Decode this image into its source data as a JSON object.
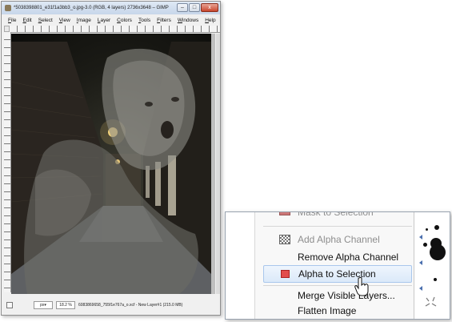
{
  "window": {
    "title": "*5038398801_e31f1a3bb3_o.jpg-3.0 (RGB, 4 layers) 2736x3648 – GIMP",
    "buttons": {
      "minimize": "–",
      "maximize": "□",
      "close": "x"
    }
  },
  "menubar": [
    "File",
    "Edit",
    "Select",
    "View",
    "Image",
    "Layer",
    "Colors",
    "Tools",
    "Filters",
    "Windows",
    "Help"
  ],
  "statusbar": {
    "unit": "px▾",
    "zoom": "18.2 %",
    "text": "6083869658_755f1e767a_o.xcf - New Layer#1 (215.0 MB)"
  },
  "context_menu": {
    "items": [
      {
        "label": "Mask to Selection",
        "state": "cut-off",
        "icon": "mask-icon"
      },
      {
        "label": "Add Alpha Channel",
        "state": "disabled",
        "icon": "checker-icon"
      },
      {
        "label": "Remove Alpha Channel",
        "state": "enabled",
        "icon": ""
      },
      {
        "label": "Alpha to Selection",
        "state": "highlighted",
        "icon": "red-square-icon"
      },
      {
        "label": "Merge Visible Layers...",
        "state": "enabled",
        "icon": ""
      },
      {
        "label": "Flatten Image",
        "state": "enabled",
        "icon": ""
      }
    ]
  },
  "colors": {
    "highlight_bg": "#dbe9f9",
    "highlight_border": "#a9c7ec",
    "disabled_text": "#8e8e8e",
    "alpha_icon": "#e24c4c"
  }
}
